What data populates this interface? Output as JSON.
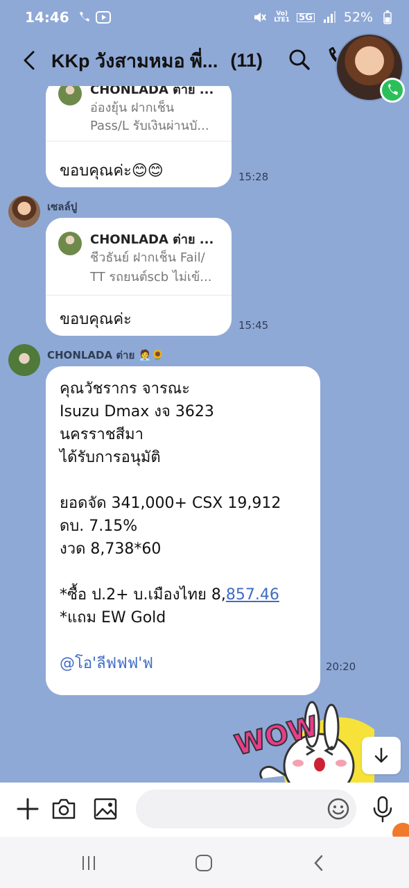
{
  "status_bar": {
    "time": "14:46",
    "battery": "52%",
    "network_top": "Vo)",
    "network_bottom": "LTE1",
    "gen": "5G"
  },
  "header": {
    "title": "KKp วังสามหมอ พี่...",
    "count": "(11)"
  },
  "messages": [
    {
      "reply_name": "CHONLADA ต่าย ...",
      "reply_line1": "อ่องยุ้น ฝากเช็น",
      "reply_line2": "Pass/L รับเงินผ่านบั...",
      "text": "ขอบคุณค่ะ😊😊",
      "time": "15:28"
    },
    {
      "sender": "เซลล์ปู",
      "reply_name": "CHONLADA ต่าย ...",
      "reply_line1": "ชีวธันย์ ฝากเช็น Fail/",
      "reply_line2": "TT รถยนต์scb ไม่เข้...",
      "text": "ขอบคุณค่ะ",
      "time": "15:45"
    },
    {
      "sender": "CHONLADA ต่าย 🧑‍💼🌻",
      "lines": [
        "คุณวัชรากร จารณะ",
        "Isuzu Dmax งจ 3623",
        "นครราชสีมา",
        "ได้รับการอนุมัติ",
        "",
        "ยอดจัด 341,000+ CSX 19,912",
        "ดบ. 7.15%",
        "งวด  8,738*60",
        "",
        "*ซื้อ ป.2+ บ.เมืองไทย 8,",
        "*แถม EW Gold",
        ""
      ],
      "link_number": "857.46",
      "mention": "@โอ'ลีฟฟฟ'ฟ",
      "time": "20:20"
    }
  ],
  "sticker": {
    "text": "WOW"
  },
  "input": {
    "placeholder": ""
  },
  "colors": {
    "background": "#8fa9d6",
    "link": "#3f6bc4",
    "call_green": "#2bbf5a"
  }
}
